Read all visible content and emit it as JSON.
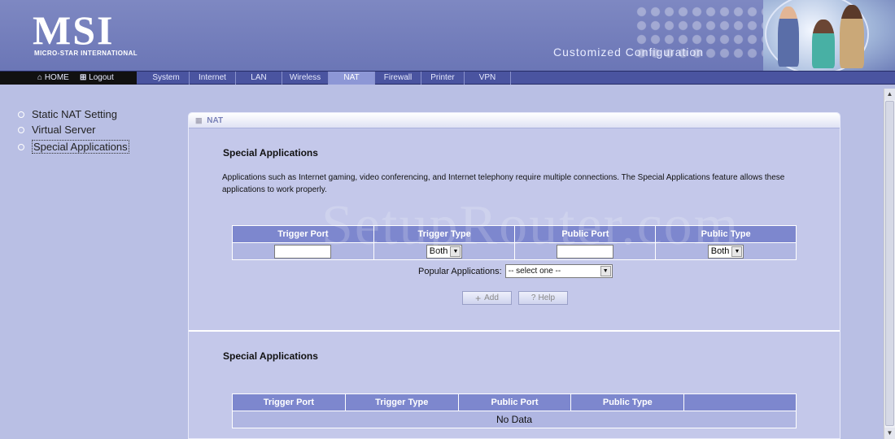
{
  "header": {
    "logo": "MSI",
    "logo_sub": "MICRO-STAR INTERNATIONAL",
    "caption": "Customized Configuration"
  },
  "nav": {
    "home": "HOME",
    "logout": "Logout",
    "tabs": [
      "System",
      "Internet",
      "LAN",
      "Wireless",
      "NAT",
      "Firewall",
      "Printer",
      "VPN"
    ],
    "active_tab": "NAT"
  },
  "sidebar": {
    "items": [
      "Static NAT Setting",
      "Virtual Server",
      "Special Applications"
    ],
    "active_item": "Special Applications"
  },
  "panel": {
    "header": "NAT",
    "section1_title": "Special Applications",
    "description": "Applications such as Internet gaming, video conferencing, and Internet telephony require multiple connections. The Special Applications feature allows these applications to work properly.",
    "form_table": {
      "headers": [
        "Trigger Port",
        "Trigger Type",
        "Public Port",
        "Public Type"
      ],
      "trigger_port_value": "",
      "trigger_type_value": "Both",
      "public_port_value": "",
      "public_type_value": "Both"
    },
    "popular_label": "Popular Applications:",
    "popular_value": "-- select one --",
    "add_button": "Add",
    "help_button": "Help",
    "section2_title": "Special Applications",
    "list_table": {
      "headers": [
        "Trigger Port",
        "Trigger Type",
        "Public Port",
        "Public Type",
        ""
      ],
      "empty_text": "No Data"
    }
  },
  "watermark": "SetupRouter.com",
  "colors": {
    "background": "#b9bfe4",
    "header": "#6b76b6",
    "table_header": "#7d87ce",
    "table_row": "#b0b6e2",
    "active_tab": "#8d97d6"
  }
}
